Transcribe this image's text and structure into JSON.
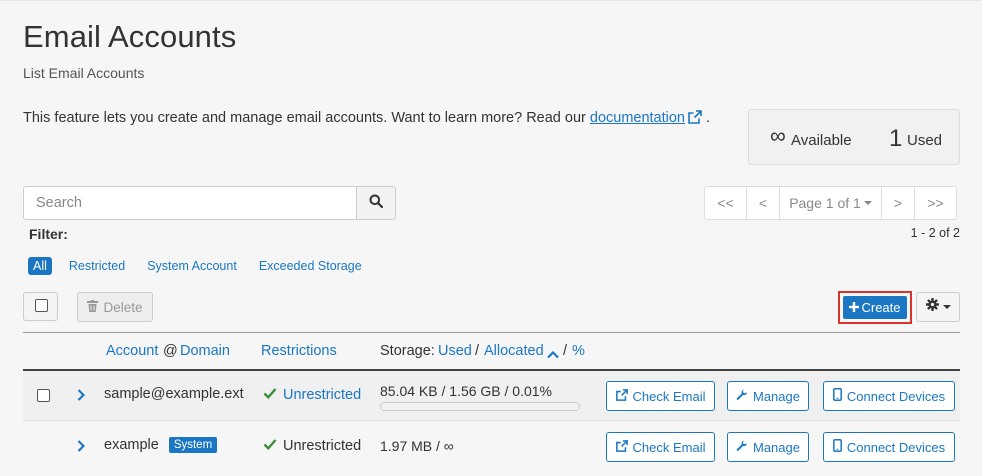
{
  "header": {
    "title": "Email Accounts",
    "subtitle": "List Email Accounts"
  },
  "intro": {
    "text": "This feature lets you create and manage email accounts. Want to learn more? Read our ",
    "link": "documentation",
    "suffix": "."
  },
  "stats": {
    "available_symbol": "∞",
    "available_label": "Available",
    "used_count": "1",
    "used_label": "Used"
  },
  "search": {
    "placeholder": "Search",
    "value": ""
  },
  "pagination": {
    "first": "<<",
    "prev": "<",
    "page_label": "Page 1 of 1",
    "next": ">",
    "last": ">>",
    "range": "1 - 2 of 2"
  },
  "filters": {
    "label": "Filter:",
    "items": [
      {
        "label": "All",
        "active": true
      },
      {
        "label": "Restricted",
        "active": false
      },
      {
        "label": "System Account",
        "active": false
      },
      {
        "label": "Exceeded Storage",
        "active": false
      }
    ]
  },
  "toolbar": {
    "delete_label": "Delete",
    "create_label": "Create"
  },
  "columns": {
    "account": "Account",
    "at": "@",
    "domain": "Domain",
    "restrictions": "Restrictions",
    "storage_prefix": "Storage:",
    "used": "Used",
    "sep1": "/",
    "allocated": "Allocated",
    "sep2": "/",
    "percent": "%"
  },
  "rows": [
    {
      "account": "sample@example.ext",
      "badge": "",
      "restriction": "Unrestricted",
      "storage": "85.04 KB / 1.56 GB / 0.01%",
      "usage_fraction": 0.0001,
      "actions": {
        "check": "Check Email",
        "manage": "Manage",
        "connect": "Connect Devices"
      }
    },
    {
      "account": "example",
      "badge": "System",
      "restriction": "Unrestricted",
      "storage": "1.97 MB / ∞",
      "actions": {
        "check": "Check Email",
        "manage": "Manage",
        "connect": "Connect Devices"
      }
    }
  ],
  "colors": {
    "accent": "#1b77c3",
    "check": "#3c8d3c",
    "highlight": "#d9342b"
  }
}
